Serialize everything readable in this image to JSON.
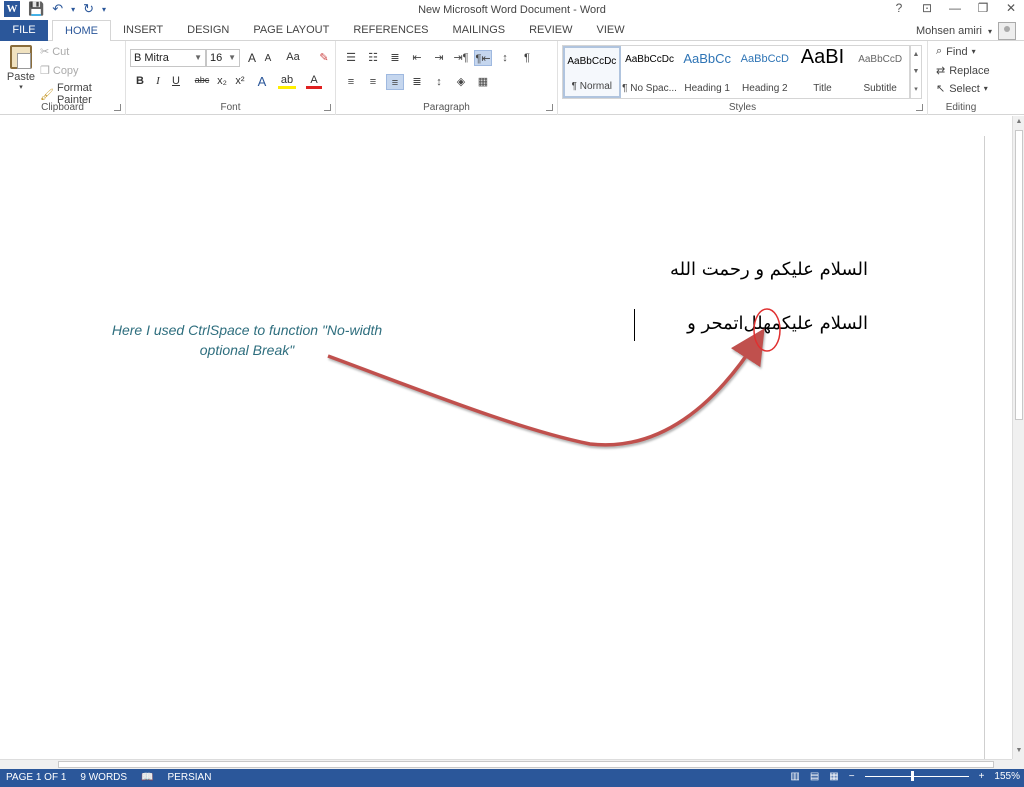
{
  "window": {
    "title": "New Microsoft Word Document - Word",
    "controls": {
      "help": "?",
      "restore_ribbon": "⊡",
      "minimize": "—",
      "maximize": "❐",
      "close": "✕"
    }
  },
  "qat": {
    "logo": "W",
    "save": "💾",
    "undo": "↶",
    "undo_arrow": "▾",
    "redo": "↻",
    "customize": "▾"
  },
  "tabs": {
    "file": "FILE",
    "items": [
      "HOME",
      "INSERT",
      "DESIGN",
      "PAGE LAYOUT",
      "REFERENCES",
      "MAILINGS",
      "REVIEW",
      "VIEW"
    ]
  },
  "user": {
    "name": "Mohsen amiri",
    "arrow": "▾"
  },
  "clipboard": {
    "label": "Clipboard",
    "paste": "Paste",
    "paste_arrow": "▾",
    "cut": "Cut",
    "copy": "Copy",
    "format_painter": "Format Painter"
  },
  "font": {
    "label": "Font",
    "name": "B Mitra",
    "size": "16",
    "grow": "A",
    "shrink": "A",
    "case": "Aa",
    "clear": "✎",
    "bold": "B",
    "italic": "I",
    "underline": "U",
    "strike": "abc",
    "subscript": "x₂",
    "superscript": "x²",
    "effects": "A",
    "highlight": "ab",
    "color": "A"
  },
  "paragraph": {
    "label": "Paragraph",
    "ltr": "⇥¶",
    "rtl": "¶⇤",
    "sort": "↕",
    "show_marks": "¶"
  },
  "styles": {
    "label": "Styles",
    "items": [
      {
        "sample": "AaBbCcDc",
        "name": "¶ Normal"
      },
      {
        "sample": "AaBbCcDc",
        "name": "¶ No Spac..."
      },
      {
        "sample": "AaBbCc",
        "name": "Heading 1"
      },
      {
        "sample": "AaBbCcD",
        "name": "Heading 2"
      },
      {
        "sample": "AaBI",
        "name": "Title"
      },
      {
        "sample": "AaBbCcD",
        "name": "Subtitle"
      }
    ]
  },
  "editing": {
    "label": "Editing",
    "find": "Find",
    "find_arrow": "▾",
    "replace": "Replace",
    "select": "Select",
    "select_arrow": "▾"
  },
  "document": {
    "line1": "السلام علیکم و رحمت الله",
    "line2": "السلام علیکمهلل‌اتمحر و",
    "annotation": "Here I used CtrlSpace to function \"No-width optional Break\""
  },
  "colors": {
    "accent": "#2b579a",
    "annotation": "#2e6e7e",
    "arrow": "#c0504d",
    "circle": "#e03030"
  },
  "status": {
    "page": "PAGE 1 OF 1",
    "words": "9 WORDS",
    "language": "PERSIAN",
    "zoom": "155%",
    "zoom_minus": "−",
    "zoom_plus": "+"
  }
}
